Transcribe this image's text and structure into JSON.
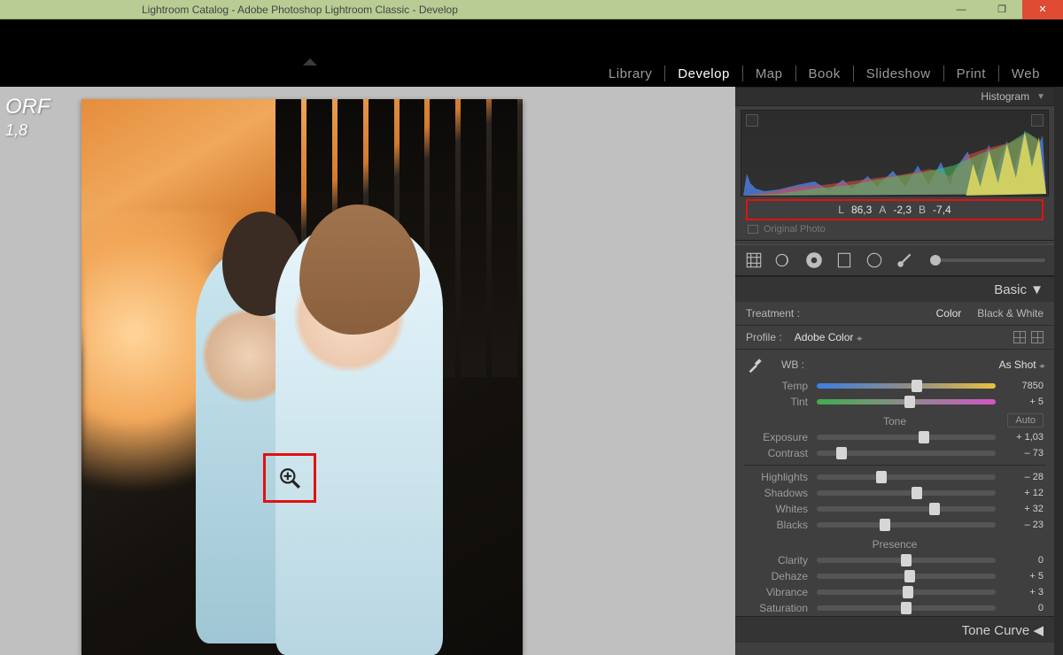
{
  "window": {
    "title": "Lightroom Catalog - Adobe Photoshop Lightroom Classic - Develop"
  },
  "modules": [
    "Library",
    "Develop",
    "Map",
    "Book",
    "Slideshow",
    "Print",
    "Web"
  ],
  "active_module": "Develop",
  "file": {
    "ext": "ORF",
    "aperture": "1,8"
  },
  "histogram": {
    "title": "Histogram",
    "lab": {
      "L_label": "L",
      "L": "86,3",
      "A_label": "A",
      "A": "-2,3",
      "B_label": "B",
      "B": "-7,4"
    },
    "original_label": "Original Photo"
  },
  "basic": {
    "title": "Basic",
    "treatment_label": "Treatment :",
    "color_label": "Color",
    "bw_label": "Black & White",
    "profile_label": "Profile :",
    "profile_value": "Adobe Color",
    "wb_label": "WB :",
    "wb_value": "As Shot",
    "temp_label": "Temp",
    "temp_value": "7850",
    "tint_label": "Tint",
    "tint_value": "+ 5",
    "tone_label": "Tone",
    "auto_label": "Auto",
    "exposure_label": "Exposure",
    "exposure_value": "+ 1,03",
    "contrast_label": "Contrast",
    "contrast_value": "– 73",
    "highlights_label": "Highlights",
    "highlights_value": "– 28",
    "shadows_label": "Shadows",
    "shadows_value": "+ 12",
    "whites_label": "Whites",
    "whites_value": "+ 32",
    "blacks_label": "Blacks",
    "blacks_value": "– 23",
    "presence_label": "Presence",
    "clarity_label": "Clarity",
    "clarity_value": "0",
    "dehaze_label": "Dehaze",
    "dehaze_value": "+ 5",
    "vibrance_label": "Vibrance",
    "vibrance_value": "+ 3",
    "saturation_label": "Saturation",
    "saturation_value": "0"
  },
  "tonecurve": {
    "title": "Tone Curve"
  },
  "slider_knobs": {
    "temp": 56,
    "tint": 52,
    "exposure": 60,
    "contrast": 14,
    "highlights": 36,
    "shadows": 56,
    "whites": 66,
    "blacks": 38,
    "clarity": 50,
    "dehaze": 52,
    "vibrance": 51,
    "saturation": 50
  }
}
